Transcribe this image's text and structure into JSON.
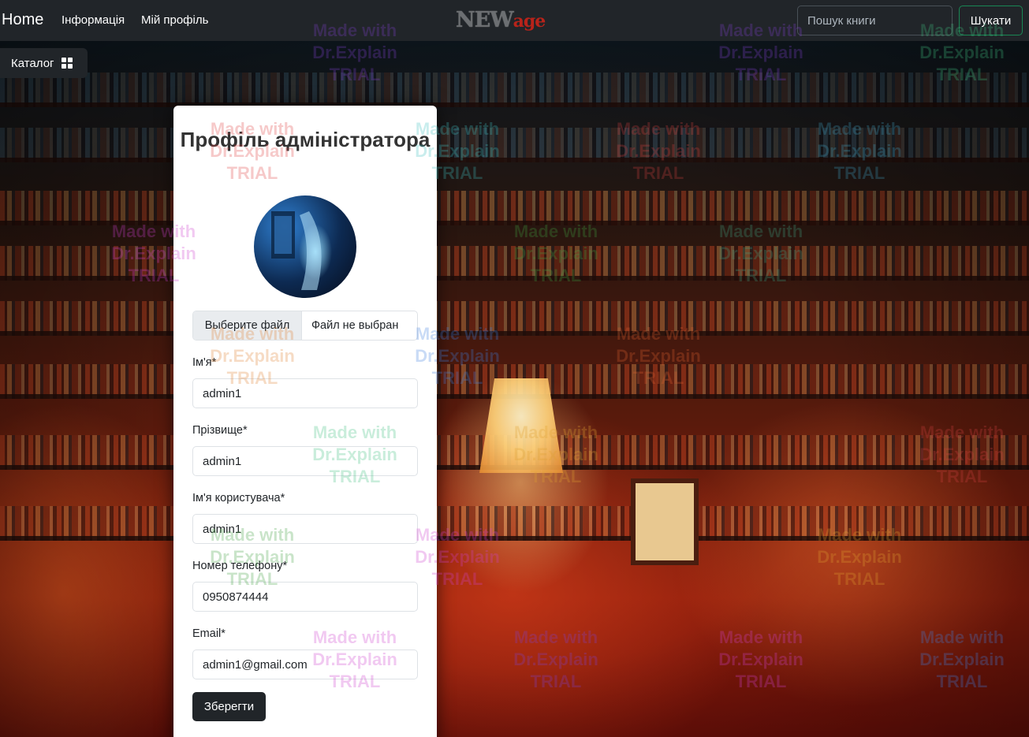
{
  "navbar": {
    "home": "Home",
    "links": [
      "Інформація",
      "Мій профіль"
    ],
    "logo_new": "NEW",
    "logo_age": "age",
    "search_placeholder": "Пошук книги",
    "search_button": "Шукати"
  },
  "catalog": {
    "label": "Каталог"
  },
  "profile": {
    "title": "Профіль адміністратора",
    "file_button": "Выберите файл",
    "file_status": "Файл не выбран",
    "fields": {
      "first_name": {
        "label": "Ім'я*",
        "value": "admin1"
      },
      "last_name": {
        "label": "Прізвище*",
        "value": "admin1"
      },
      "username": {
        "label": "Ім'я користувача*",
        "value": "admin1"
      },
      "phone": {
        "label": "Номер телефону*",
        "value": "0950874444"
      },
      "email": {
        "label": "Email*",
        "value": "admin1@gmail.com"
      }
    },
    "save_button": "Зберегти"
  },
  "watermark": [
    "Made with",
    "Dr.Explain",
    "TRIAL"
  ],
  "colors": {
    "navbar": "#212529",
    "search_button_border": "#198754",
    "logo_age": "#b8231a",
    "card": "#ffffff"
  }
}
